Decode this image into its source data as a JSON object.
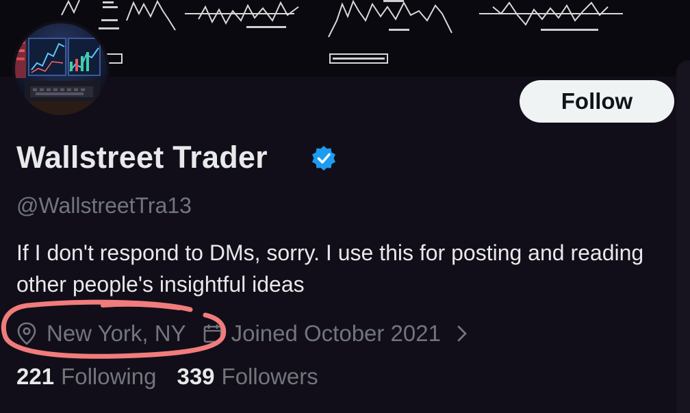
{
  "profile": {
    "display_name": "Wallstreet Trader",
    "handle": "@WallstreetTra13",
    "bio": "If I don't respond to DMs, sorry. I use this for posting and reading other people's insightful ideas",
    "location": "New York, NY",
    "joined": "Joined October 2021",
    "verified": true
  },
  "follow_button": {
    "label": "Follow"
  },
  "stats": {
    "following_count": "221",
    "following_label": "Following",
    "followers_count": "339",
    "followers_label": "Followers"
  },
  "colors": {
    "background": "#120e19",
    "primary_text": "#e7e9ea",
    "secondary_text": "#71767b",
    "verified_badge": "#1d9bf0",
    "annotation_circle": "#f07c7c",
    "follow_button_bg": "#eff3f4"
  },
  "icons": {
    "verified": "verified-badge-icon",
    "location": "location-pin-icon",
    "joined": "calendar-icon",
    "more": "chevron-right-icon"
  }
}
